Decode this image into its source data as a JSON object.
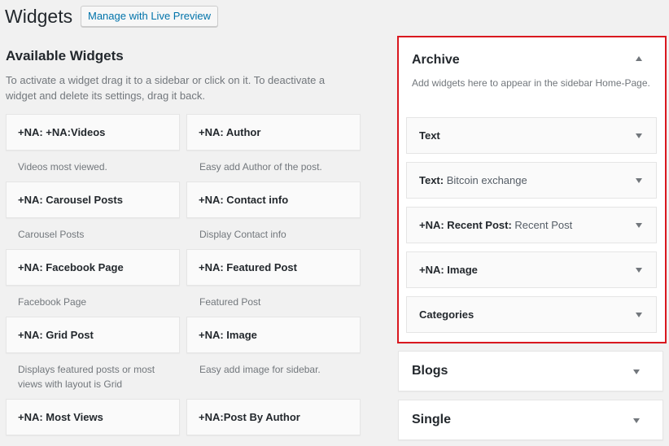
{
  "page": {
    "title": "Widgets",
    "live_preview_label": "Manage with Live Preview"
  },
  "available": {
    "title": "Available Widgets",
    "description": "To activate a widget drag it to a sidebar or click on it. To deactivate a widget and delete its settings, drag it back.",
    "widgets": [
      {
        "name": "+NA: +NA:Videos",
        "desc": "Videos most viewed."
      },
      {
        "name": "+NA: Author",
        "desc": "Easy add Author of the post."
      },
      {
        "name": "+NA: Carousel Posts",
        "desc": "Carousel Posts"
      },
      {
        "name": "+NA: Contact info",
        "desc": "Display Contact info"
      },
      {
        "name": "+NA: Facebook Page",
        "desc": "Facebook Page"
      },
      {
        "name": "+NA: Featured Post",
        "desc": "Featured Post"
      },
      {
        "name": "+NA: Grid Post",
        "desc": "Displays featured posts or most views with layout is Grid"
      },
      {
        "name": "+NA: Image",
        "desc": "Easy add image for sidebar."
      },
      {
        "name": "+NA: Most Views",
        "desc": ""
      },
      {
        "name": "+NA:Post By Author",
        "desc": ""
      }
    ]
  },
  "sidebars": {
    "archive": {
      "title": "Archive",
      "description": "Add widgets here to appear in the sidebar Home-Page.",
      "widgets": [
        {
          "name": "Text",
          "subtitle": ""
        },
        {
          "name": "Text:",
          "subtitle": " Bitcoin exchange"
        },
        {
          "name": "+NA: Recent Post:",
          "subtitle": " Recent Post"
        },
        {
          "name": "+NA: Image",
          "subtitle": ""
        },
        {
          "name": "Categories",
          "subtitle": ""
        }
      ]
    },
    "blogs": {
      "title": "Blogs"
    },
    "single": {
      "title": "Single"
    }
  },
  "colors": {
    "highlight_border": "#d9181f",
    "link": "#0073aa",
    "background": "#f1f1f1"
  }
}
